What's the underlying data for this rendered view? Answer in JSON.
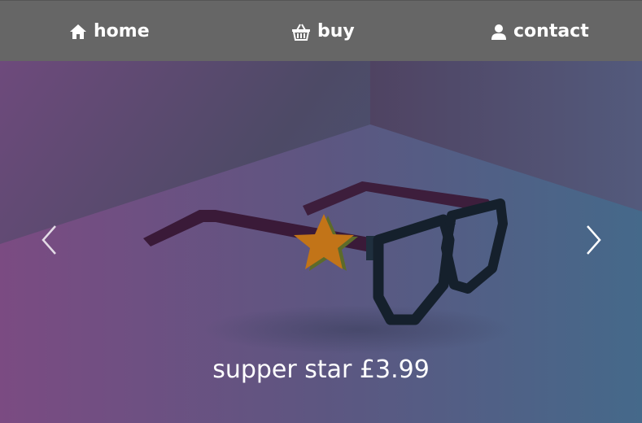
{
  "nav": {
    "items": [
      {
        "label": "home",
        "icon": "home-icon"
      },
      {
        "label": "buy",
        "icon": "basket-icon"
      },
      {
        "label": "contact",
        "icon": "user-icon"
      }
    ]
  },
  "carousel": {
    "caption": "supper star £3.99",
    "prev_icon": "chevron-left-icon",
    "next_icon": "chevron-right-icon",
    "image": "star-glasses-3d-render"
  },
  "colors": {
    "navbar": "#666666",
    "text": "#ffffff",
    "bg_purple": "#7a4a80",
    "bg_blue": "#456686"
  }
}
